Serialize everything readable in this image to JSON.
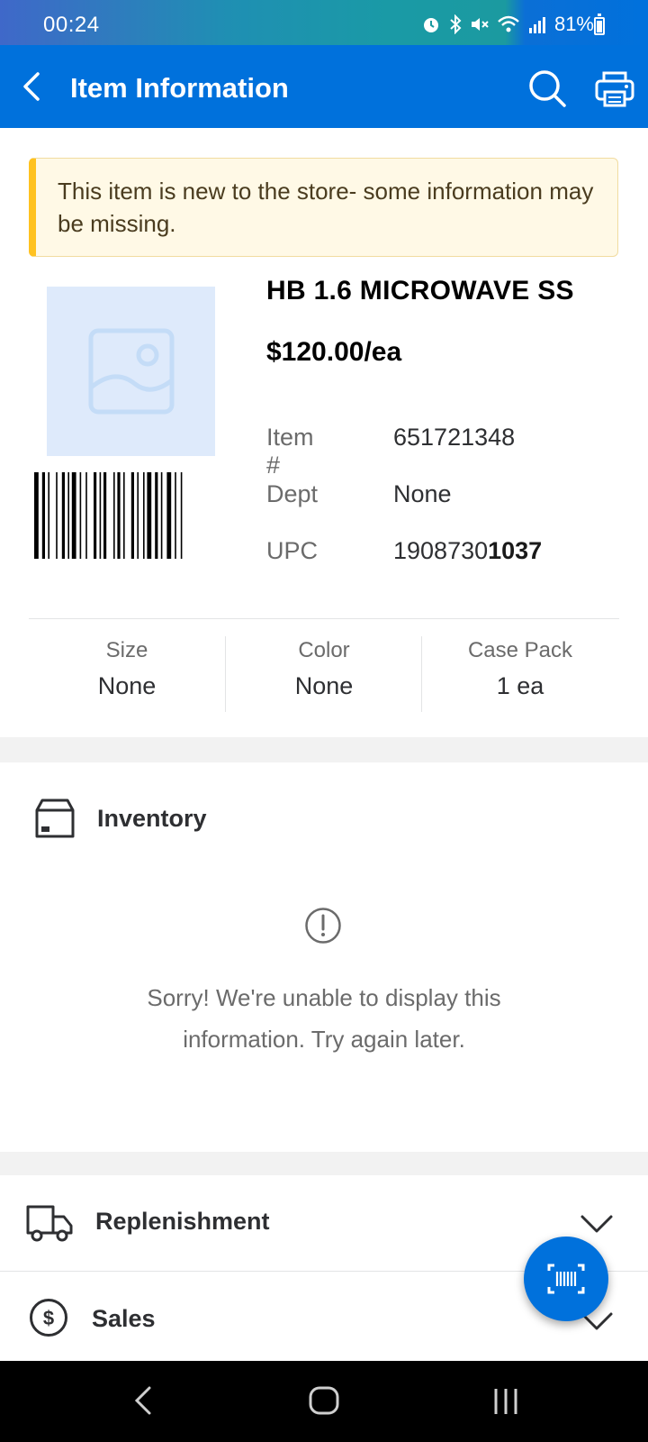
{
  "status_bar": {
    "time": "00:24",
    "battery": "81%",
    "icons": [
      "alarm-icon",
      "bluetooth-icon",
      "mute-icon",
      "wifi-icon",
      "signal-icon",
      "battery-icon"
    ]
  },
  "app_bar": {
    "title": "Item Information",
    "icons": [
      "back-arrow-icon",
      "search-icon",
      "print-icon"
    ]
  },
  "banner": {
    "text": "This item is new to the store- some information may be missing."
  },
  "product": {
    "name": "HB 1.6 MICROWAVE SS",
    "price": "$120.00/ea",
    "details": [
      {
        "label": "Item #",
        "value": "651721348"
      },
      {
        "label": "Dept",
        "value": "None"
      },
      {
        "label": "UPC",
        "value_prefix": "1908730",
        "value_bold": "1037"
      }
    ],
    "attributes": [
      {
        "label": "Size",
        "value": "None"
      },
      {
        "label": "Color",
        "value": "None"
      },
      {
        "label": "Case Pack",
        "value": "1 ea"
      }
    ]
  },
  "inventory": {
    "title": "Inventory",
    "error_message": "Sorry! We're unable to display this information. Try again later."
  },
  "sections": [
    {
      "title": "Replenishment",
      "icon": "truck-icon"
    },
    {
      "title": "Sales",
      "icon": "dollar-icon"
    }
  ],
  "colors": {
    "brand_blue": "#0071dc",
    "warning_yellow": "#ffc220",
    "warning_bg": "#fff9e6"
  }
}
